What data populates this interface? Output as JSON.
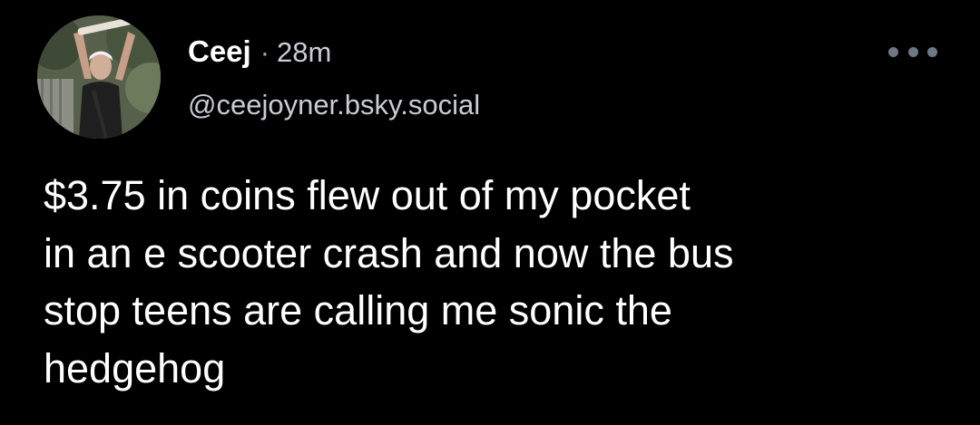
{
  "post": {
    "author": {
      "display_name": "Ceej",
      "handle": "@ceejoyner.bsky.social",
      "avatar_icon": "person-photo-avatar"
    },
    "separator": "·",
    "timestamp": "28m",
    "more_icon": "more-horizontal-icon",
    "text": "$3.75 in coins flew out of my pocket\nin an e scooter crash and now the bus\nstop teens are calling me sonic the\nhedgehog"
  },
  "colors": {
    "background": "#000000",
    "primary_text": "#ffffff",
    "secondary_text": "#c8ccd4",
    "icon_gray": "#6f7782"
  }
}
